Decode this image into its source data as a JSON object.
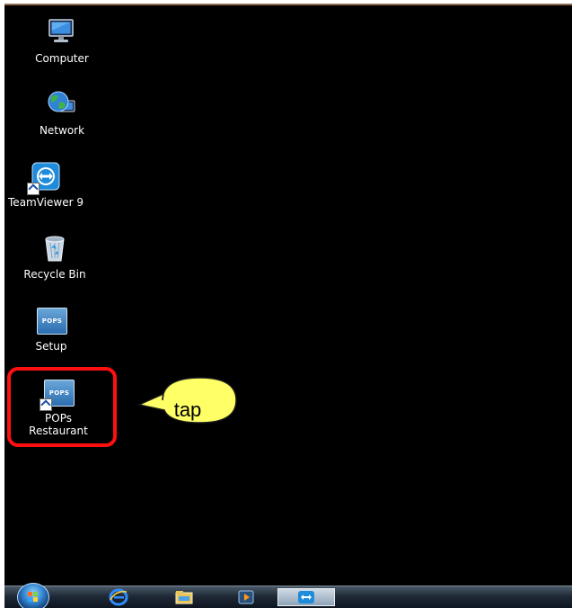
{
  "desktop": {
    "icons": [
      {
        "label": "Computer"
      },
      {
        "label": "Network"
      },
      {
        "label": "TeamViewer 9"
      },
      {
        "label": "Recycle Bin"
      },
      {
        "label": "Setup",
        "tile_text": "POPS"
      },
      {
        "label": "POPs Restaurant",
        "tile_text": "POPS"
      }
    ]
  },
  "annotation": {
    "callout_text": "tap",
    "highlight_color": "#ff1010",
    "callout_fill": "#ffff66"
  },
  "taskbar": {
    "items": [
      "start-orb",
      "internet-explorer-icon",
      "file-explorer-icon",
      "media-player-icon",
      "teamviewer-icon"
    ]
  }
}
